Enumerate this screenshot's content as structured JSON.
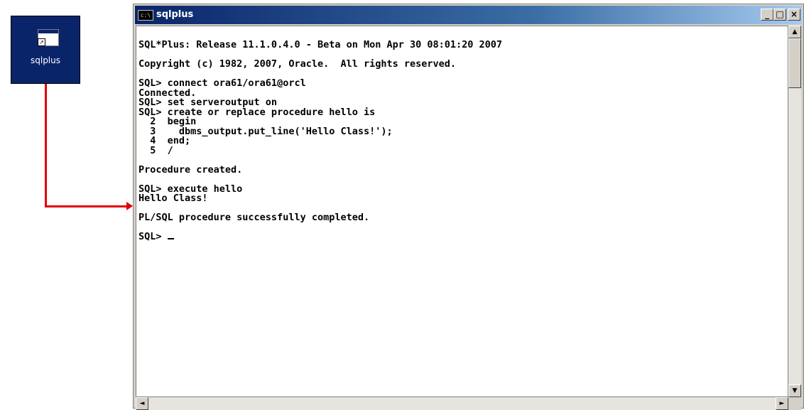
{
  "desktop": {
    "shortcut_label": "sqlplus"
  },
  "window": {
    "title": "sqlplus",
    "icon_text": "c:\\",
    "buttons": {
      "minimize": "_",
      "maximize": "□",
      "close": "×"
    }
  },
  "console": {
    "lines": [
      "SQL*Plus: Release 11.1.0.4.0 - Beta on Mon Apr 30 08:01:20 2007",
      "",
      "Copyright (c) 1982, 2007, Oracle.  All rights reserved.",
      "",
      "SQL> connect ora61/ora61@orcl",
      "Connected.",
      "SQL> set serveroutput on",
      "SQL> create or replace procedure hello is",
      "  2  begin",
      "  3    dbms_output.put_line('Hello Class!');",
      "  4  end;",
      "  5  /",
      "",
      "Procedure created.",
      "",
      "SQL> execute hello",
      "Hello Class!",
      "",
      "PL/SQL procedure successfully completed.",
      "",
      "SQL> "
    ]
  },
  "scrollbar": {
    "up": "▲",
    "down": "▼",
    "left": "◄",
    "right": "►"
  },
  "colors": {
    "desktop_icon_bg": "#0a246a",
    "arrow": "#e00000",
    "title_gradient_start": "#0a246a",
    "title_gradient_end": "#a6caf0"
  }
}
